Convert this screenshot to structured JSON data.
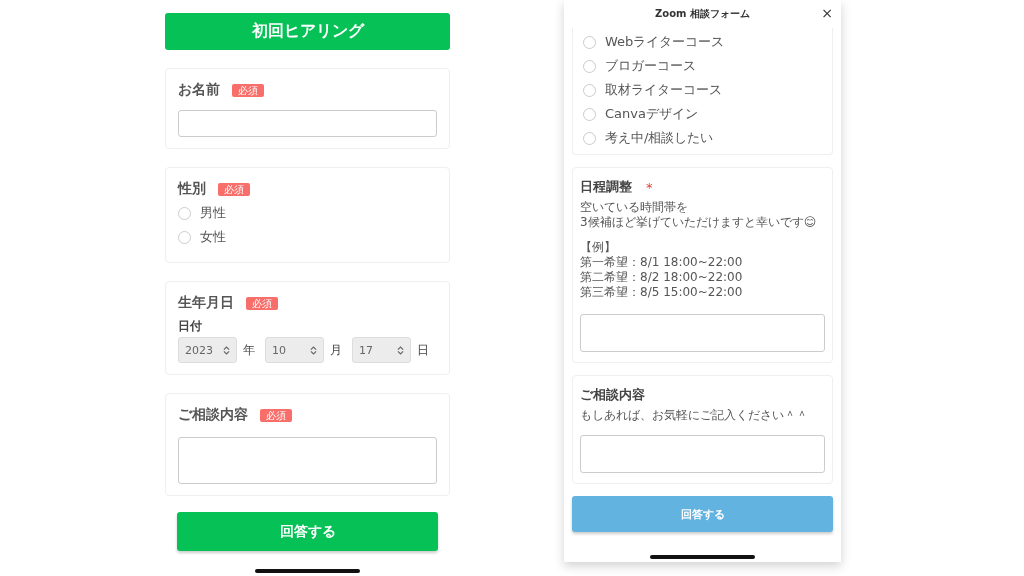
{
  "left_form": {
    "title": "初回ヒアリング",
    "fields": [
      {
        "kind": "text",
        "label": "お名前",
        "badge": "必須"
      },
      {
        "kind": "radio",
        "label": "性別",
        "badge": "必須",
        "options": [
          {
            "label": "男性",
            "selected": false
          },
          {
            "label": "女性",
            "selected": false
          }
        ]
      },
      {
        "kind": "date",
        "label": "生年月日",
        "badge": "必須",
        "sublabel": "日付",
        "parts": [
          {
            "value": "2023",
            "unit": "年"
          },
          {
            "value": "10",
            "unit": "月"
          },
          {
            "value": "17",
            "unit": "日"
          }
        ]
      },
      {
        "kind": "textarea",
        "label": "ご相談内容",
        "badge": "必須"
      }
    ],
    "submit": "回答する"
  },
  "right_form": {
    "title": "Zoom 相談フォーム",
    "close": "×",
    "fields": [
      {
        "kind": "radio",
        "options": [
          {
            "label": "Webライターコース",
            "selected": false
          },
          {
            "label": "ブロガーコース",
            "selected": false
          },
          {
            "label": "取材ライターコース",
            "selected": false
          },
          {
            "label": "Canvaデザイン",
            "selected": false
          },
          {
            "label": "考え中/相談したい",
            "selected": false
          }
        ]
      },
      {
        "kind": "textarea",
        "label": "日程調整",
        "required_mark": "*",
        "description": [
          [
            "空いている時間帯を",
            "3候補ほど挙げていただけますと幸いです😊"
          ],
          [
            "【例】",
            "第一希望：8/1 18:00~22:00",
            "第二希望：8/2 18:00~22:00",
            "第三希望：8/5 15:00~22:00"
          ]
        ]
      },
      {
        "kind": "textarea",
        "label": "ご相談内容",
        "description": [
          [
            "もしあれば、お気軽にご記入ください＾＾"
          ]
        ]
      }
    ],
    "submit": "回答する"
  }
}
